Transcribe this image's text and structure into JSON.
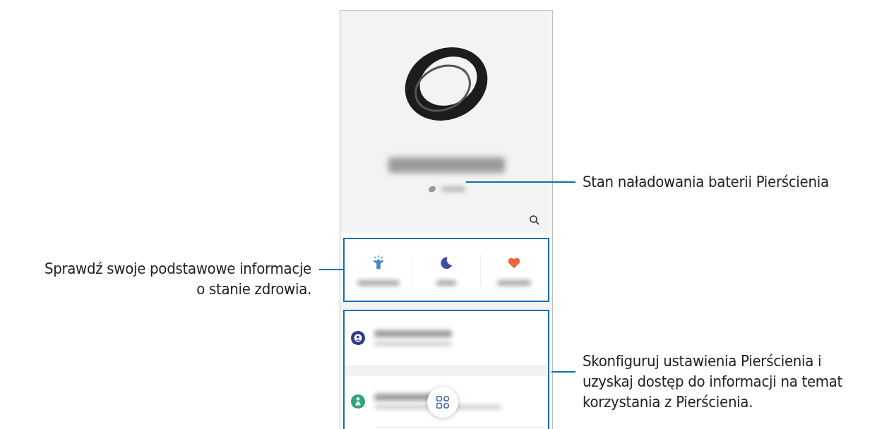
{
  "callouts": [
    {
      "kind": "battery",
      "lines": [
        "Stan naładowania baterii Pierścienia"
      ]
    },
    {
      "kind": "health",
      "lines": [
        "Sprawdź swoje podstawowe informacje",
        "o stanie zdrowia."
      ]
    },
    {
      "kind": "settings",
      "lines": [
        "Skonfiguruj ustawienia Pierścienia i",
        "uzyskaj dostęp do informacji na temat",
        "korzystania z Pierścienia."
      ]
    }
  ]
}
